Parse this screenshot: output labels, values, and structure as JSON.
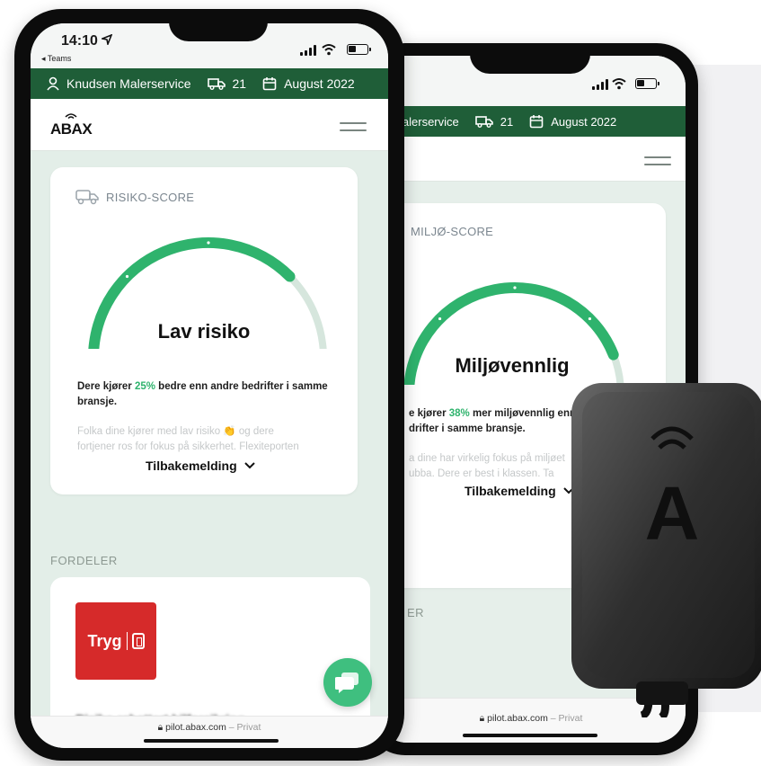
{
  "front_phone": {
    "time": "14:10",
    "back_app": "◂ Teams",
    "company": "Knudsen Malerservice",
    "vehicle_count": "21",
    "period": "August 2022",
    "logo": "ABAX",
    "card": {
      "label": "RISIKO-SCORE",
      "title": "Lav risiko",
      "desc_pre": "Dere kjører ",
      "desc_pct": "25%",
      "desc_post": " bedre enn andre bedrifter i samme bransje.",
      "faded_line1": "Folka dine kjører med lav risiko 👏 og dere",
      "faded_line2": "fortjener ros for fokus på sikkerhet. Flexiteporten",
      "feedback": "Tilbakemelding",
      "gauge_fraction": 0.75
    },
    "section_label": "FORDELER",
    "benefit": {
      "brand": "Tryg",
      "title": "Risiko-rabattert bilforsikring"
    },
    "url": "pilot.abax.com",
    "url_suffix": " – Privat"
  },
  "back_phone": {
    "company": "en Malerservice",
    "vehicle_count": "21",
    "period": "August 2022",
    "card": {
      "label": "MILJØ-SCORE",
      "title": "Miljøvennlig",
      "desc_pre": "e kjører ",
      "desc_pct": "38%",
      "desc_post": " mer miljøvennlig enn",
      "desc_line2": "drifter i samme bransje.",
      "faded_line1": "a dine har virkelig fokus på miljøet",
      "faded_line2": "ubba. Dere er best i klassen. Ta",
      "feedback": "Tilbakemelding",
      "gauge_fraction": 0.88
    },
    "section_label": "ER",
    "url": "pilot.abax.com",
    "url_suffix": " – Privat"
  },
  "device": {
    "letter": "A"
  },
  "colors": {
    "brand_green": "#1f5e38",
    "accent": "#2fb36d",
    "tryg_red": "#d62a2a",
    "chat": "#3fbf7f"
  }
}
